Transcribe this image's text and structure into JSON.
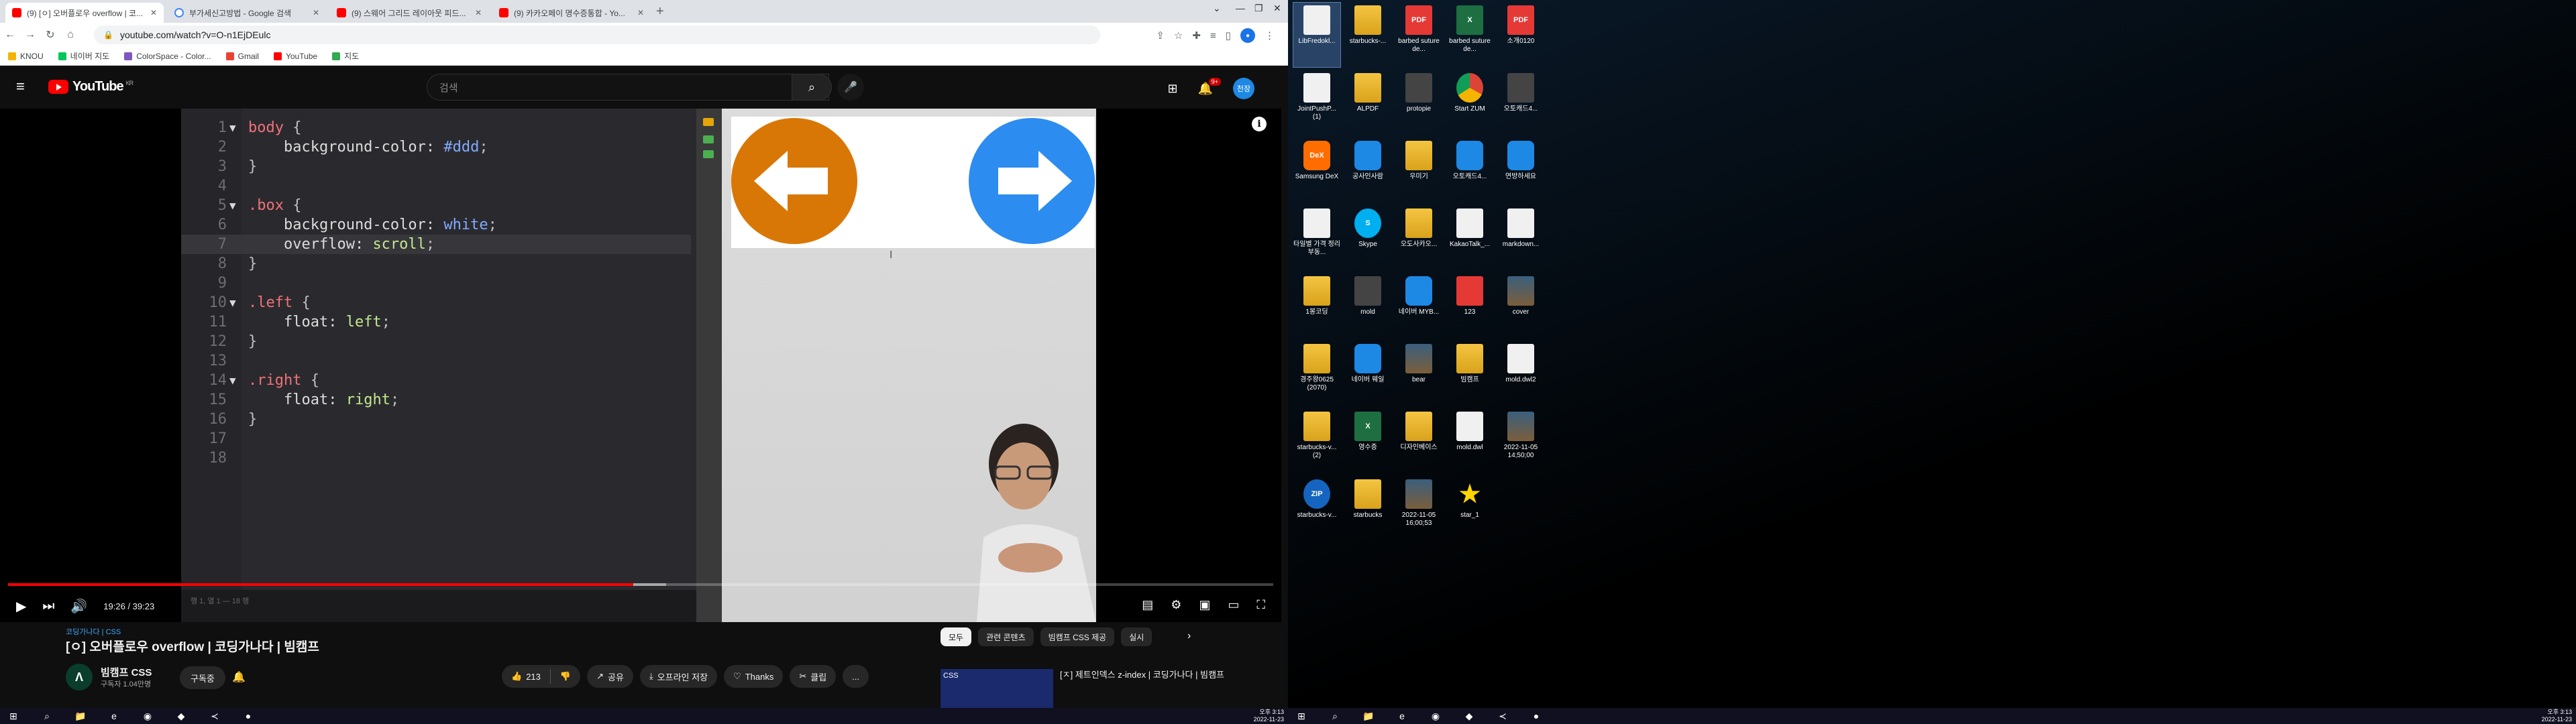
{
  "browser": {
    "tabs": [
      {
        "title": "(9) [ㅇ] 오버플로우 overflow | 코...",
        "favicon": "youtube",
        "active": true
      },
      {
        "title": "부가세신고방법 - Google 검색",
        "favicon": "google",
        "active": false
      },
      {
        "title": "(9) 스웨어 그리드 레이아웃 피드...",
        "favicon": "youtube",
        "active": false
      },
      {
        "title": "(9) 카카오페이 명수증통합 - Yo...",
        "favicon": "youtube",
        "active": false
      }
    ],
    "url": "youtube.com/watch?v=O-n1EjDEulc",
    "bookmarks": [
      "KNOU",
      "네이버 지도",
      "ColorSpace - Color...",
      "Gmail",
      "YouTube",
      "지도"
    ]
  },
  "youtube": {
    "logo_text": "YouTube",
    "logo_region": "KR",
    "search_placeholder": "검색",
    "notif_count": "9+",
    "avatar_text": "천장",
    "player": {
      "time": "19:26 / 39:23",
      "progress_fraction": 0.494,
      "loaded_fraction": 0.52,
      "editor_status": "행 1, 열 1 — 18 행"
    },
    "code_lines": [
      {
        "n": "1",
        "fold": "▼",
        "tokens": [
          {
            "t": "body",
            "c": "sel"
          },
          {
            "t": " {",
            "c": "punc"
          }
        ]
      },
      {
        "n": "2",
        "fold": "",
        "tokens": [
          {
            "t": "    background-color: ",
            "c": "prop"
          },
          {
            "t": "#ddd",
            "c": "val-h"
          },
          {
            "t": ";",
            "c": "punc"
          }
        ]
      },
      {
        "n": "3",
        "fold": "",
        "tokens": [
          {
            "t": "}",
            "c": "punc"
          }
        ]
      },
      {
        "n": "4",
        "fold": "",
        "tokens": []
      },
      {
        "n": "5",
        "fold": "▼",
        "tokens": [
          {
            "t": ".box",
            "c": "sel"
          },
          {
            "t": " {",
            "c": "punc"
          }
        ]
      },
      {
        "n": "6",
        "fold": "",
        "tokens": [
          {
            "t": "    background-color: ",
            "c": "prop"
          },
          {
            "t": "white",
            "c": "val-h"
          },
          {
            "t": ";",
            "c": "punc"
          }
        ]
      },
      {
        "n": "7",
        "fold": "",
        "tokens": [
          {
            "t": "    overflow: ",
            "c": "prop"
          },
          {
            "t": "scroll",
            "c": "val-k"
          },
          {
            "t": ";",
            "c": "punc"
          }
        ],
        "highlight": true
      },
      {
        "n": "8",
        "fold": "",
        "tokens": [
          {
            "t": "}",
            "c": "punc"
          }
        ]
      },
      {
        "n": "9",
        "fold": "",
        "tokens": []
      },
      {
        "n": "10",
        "fold": "▼",
        "tokens": [
          {
            "t": ".left",
            "c": "sel"
          },
          {
            "t": " {",
            "c": "punc"
          }
        ]
      },
      {
        "n": "11",
        "fold": "",
        "tokens": [
          {
            "t": "    float: ",
            "c": "prop"
          },
          {
            "t": "left",
            "c": "val-k"
          },
          {
            "t": ";",
            "c": "punc"
          }
        ]
      },
      {
        "n": "12",
        "fold": "",
        "tokens": [
          {
            "t": "}",
            "c": "punc"
          }
        ]
      },
      {
        "n": "13",
        "fold": "",
        "tokens": []
      },
      {
        "n": "14",
        "fold": "▼",
        "tokens": [
          {
            "t": ".right",
            "c": "sel"
          },
          {
            "t": " {",
            "c": "punc"
          }
        ]
      },
      {
        "n": "15",
        "fold": "",
        "tokens": [
          {
            "t": "    float: ",
            "c": "prop"
          },
          {
            "t": "right",
            "c": "val-k"
          },
          {
            "t": ";",
            "c": "punc"
          }
        ]
      },
      {
        "n": "16",
        "fold": "",
        "tokens": [
          {
            "t": "}",
            "c": "punc"
          }
        ]
      },
      {
        "n": "17",
        "fold": "",
        "tokens": []
      },
      {
        "n": "18",
        "fold": "",
        "tokens": []
      }
    ],
    "hashtags": "코딩가나다 | CSS",
    "video_title": "[ㅇ] 오버플로우 overflow | 코딩가나다 | 빔캠프",
    "channel": {
      "name": "빔캠프 CSS",
      "avatar": "Λ",
      "subs": "구독자 1.04만명",
      "subscribe_label": "구독중"
    },
    "actions": {
      "likes": "213",
      "share": "공유",
      "offline": "오프라인 저장",
      "thanks": "Thanks",
      "clip": "클립",
      "more": "..."
    },
    "chips": [
      "모두",
      "관련 콘텐츠",
      "빔캠프 CSS 제공",
      "실시"
    ],
    "recommendation": {
      "thumb_text": "CSS",
      "title": "[ㅈ] 제트인덱스 z-index | 코딩가나다 | 빔캠프"
    }
  },
  "taskbar_clock": {
    "time": "오후 3:13",
    "date": "2022-11-23"
  },
  "desktop_icons": [
    {
      "label": "LibFredokl...",
      "kind": "doc",
      "selected": true
    },
    {
      "label": "starbucks-...",
      "kind": "folder"
    },
    {
      "label": "barbed suture de...",
      "kind": "pdf",
      "icon": "PDF"
    },
    {
      "label": "barbed suture de...",
      "kind": "xls",
      "icon": "X"
    },
    {
      "label": "소개0120",
      "kind": "pdf",
      "icon": "PDF"
    },
    {
      "label": "JointPushP... (1)",
      "kind": "doc"
    },
    {
      "label": "ALPDF",
      "kind": "folder"
    },
    {
      "label": "protopie",
      "kind": "dark"
    },
    {
      "label": "Start ZUM",
      "kind": "chrome"
    },
    {
      "label": "오토캐드4...",
      "kind": "dark"
    },
    {
      "label": "Samsung DeX",
      "kind": "app-orange",
      "icon": "DeX"
    },
    {
      "label": "공사인사람",
      "kind": "app-blue"
    },
    {
      "label": "우미기",
      "kind": "folder"
    },
    {
      "label": "오토캐드4...",
      "kind": "app-blue"
    },
    {
      "label": "연방하세요",
      "kind": "app-blue"
    },
    {
      "label": "타일별 가격 정리 부동...",
      "kind": "doc"
    },
    {
      "label": "Skype",
      "kind": "skype",
      "icon": "S"
    },
    {
      "label": "오도사카오...",
      "kind": "folder"
    },
    {
      "label": "KakaoTalk_...",
      "kind": "doc"
    },
    {
      "label": "markdown...",
      "kind": "doc"
    },
    {
      "label": "1봉코딩",
      "kind": "folder"
    },
    {
      "label": "mold",
      "kind": "dark"
    },
    {
      "label": "네이버 MYB...",
      "kind": "app-blue"
    },
    {
      "label": "123",
      "kind": "pdf"
    },
    {
      "label": "cover",
      "kind": "photo"
    },
    {
      "label": "경주왕0625 (2070)",
      "kind": "folder"
    },
    {
      "label": "네이버 웨일",
      "kind": "app-blue"
    },
    {
      "label": "bear",
      "kind": "photo"
    },
    {
      "label": "빔캠프",
      "kind": "folder"
    },
    {
      "label": "mold.dwl2",
      "kind": "doc"
    },
    {
      "label": "starbucks-v... (2)",
      "kind": "folder"
    },
    {
      "label": "영수증",
      "kind": "xls",
      "icon": "X"
    },
    {
      "label": "디자인베이스",
      "kind": "folder"
    },
    {
      "label": "mold.dwl",
      "kind": "doc"
    },
    {
      "label": "2022-11-05 14;50;00",
      "kind": "photo"
    },
    {
      "label": "starbucks-v...",
      "kind": "zip",
      "icon": "ZIP"
    },
    {
      "label": "starbucks",
      "kind": "folder"
    },
    {
      "label": "2022-11-05 16;00;53",
      "kind": "photo"
    },
    {
      "label": "star_1",
      "kind": "star",
      "icon": "★"
    }
  ]
}
